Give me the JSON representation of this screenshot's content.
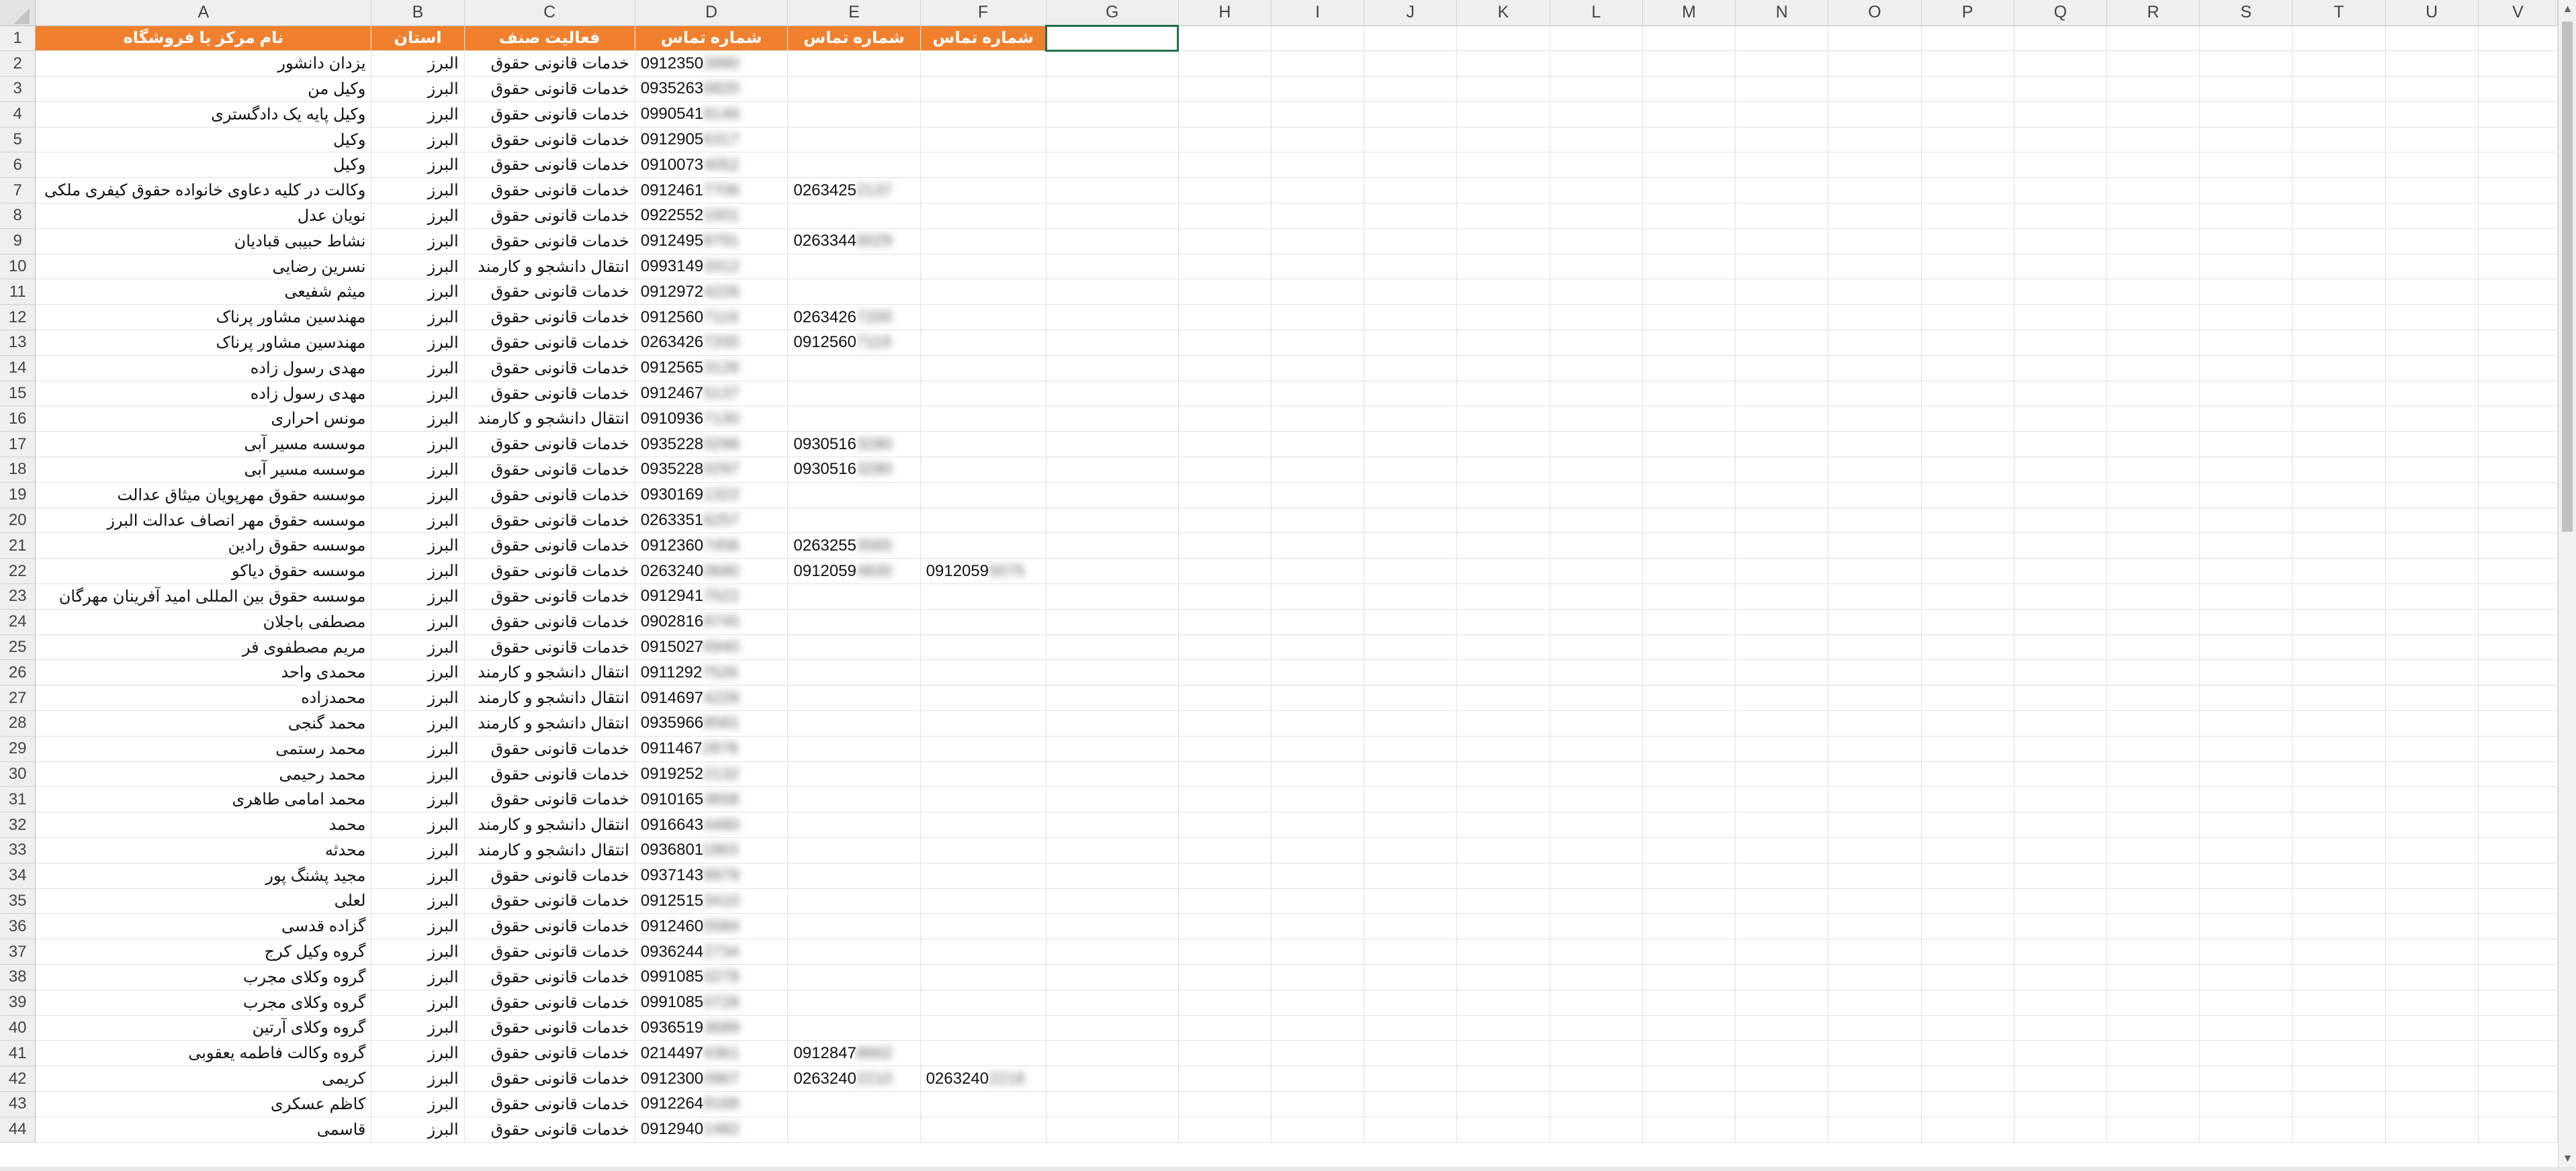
{
  "columns": [
    "A",
    "B",
    "C",
    "D",
    "E",
    "F",
    "G",
    "H",
    "I",
    "J",
    "K",
    "L",
    "M",
    "N",
    "O",
    "P",
    "Q",
    "R",
    "S",
    "T",
    "U",
    "V"
  ],
  "headers": {
    "a": "نام مرکز یا فروشگاه",
    "b": "استان",
    "c": "فعالیت صنف",
    "d": "شماره تماس",
    "e": "شماره تماس",
    "f": "شماره تماس"
  },
  "rows": [
    {
      "n": "2",
      "a": "یزدان دانشور",
      "b": "البرز",
      "c": "خدمات قانونی حقوق",
      "d1": "0912350",
      "d2": "3990",
      "e1": "",
      "e2": "",
      "f1": "",
      "f2": ""
    },
    {
      "n": "3",
      "a": "وکیل من",
      "b": "البرز",
      "c": "خدمات قانونی حقوق",
      "d1": "0935263",
      "d2": "6820",
      "e1": "",
      "e2": "",
      "f1": "",
      "f2": ""
    },
    {
      "n": "4",
      "a": "وکیل پایه یک دادگستری",
      "b": "البرز",
      "c": "خدمات قانونی حقوق",
      "d1": "0990541",
      "d2": "8146",
      "e1": "",
      "e2": "",
      "f1": "",
      "f2": ""
    },
    {
      "n": "5",
      "a": "وکیل",
      "b": "البرز",
      "c": "خدمات قانونی حقوق",
      "d1": "0912905",
      "d2": "6317",
      "e1": "",
      "e2": "",
      "f1": "",
      "f2": ""
    },
    {
      "n": "6",
      "a": "وکیل",
      "b": "البرز",
      "c": "خدمات قانونی حقوق",
      "d1": "0910073",
      "d2": "4052",
      "e1": "",
      "e2": "",
      "f1": "",
      "f2": ""
    },
    {
      "n": "7",
      "a": "وکالت در کلیه دعاوی خانواده حقوق کیفری ملکی",
      "b": "البرز",
      "c": "خدمات قانونی حقوق",
      "d1": "0912461",
      "d2": "7706",
      "e1": "0263425",
      "e2": "2137",
      "f1": "",
      "f2": ""
    },
    {
      "n": "8",
      "a": "نویان عدل",
      "b": "البرز",
      "c": "خدمات قانونی حقوق",
      "d1": "0922552",
      "d2": "1501",
      "e1": "",
      "e2": "",
      "f1": "",
      "f2": ""
    },
    {
      "n": "9",
      "a": "نشاط حبیبی قبادیان",
      "b": "البرز",
      "c": "خدمات قانونی حقوق",
      "d1": "0912495",
      "d2": "8791",
      "e1": "0263344",
      "e2": "0029",
      "f1": "",
      "f2": ""
    },
    {
      "n": "10",
      "a": "نسرین رضایی",
      "b": "البرز",
      "c": "انتقال دانشجو و کارمند",
      "d1": "0993149",
      "d2": "3312",
      "e1": "",
      "e2": "",
      "f1": "",
      "f2": ""
    },
    {
      "n": "11",
      "a": "میثم شفیعی",
      "b": "البرز",
      "c": "خدمات قانونی حقوق",
      "d1": "0912972",
      "d2": "4226",
      "e1": "",
      "e2": "",
      "f1": "",
      "f2": ""
    },
    {
      "n": "12",
      "a": "مهندسین مشاور پرناک",
      "b": "البرز",
      "c": "خدمات قانونی حقوق",
      "d1": "0912560",
      "d2": "7119",
      "e1": "0263426",
      "e2": "7200",
      "f1": "",
      "f2": ""
    },
    {
      "n": "13",
      "a": "مهندسین مشاور پرناک",
      "b": "البرز",
      "c": "خدمات قانونی حقوق",
      "d1": "0263426",
      "d2": "7200",
      "e1": "0912560",
      "e2": "7119",
      "f1": "",
      "f2": ""
    },
    {
      "n": "14",
      "a": "مهدی رسول زاده",
      "b": "البرز",
      "c": "خدمات قانونی حقوق",
      "d1": "0912565",
      "d2": "3126",
      "e1": "",
      "e2": "",
      "f1": "",
      "f2": ""
    },
    {
      "n": "15",
      "a": "مهدی رسول زاده",
      "b": "البرز",
      "c": "خدمات قانونی حقوق",
      "d1": "0912467",
      "d2": "5137",
      "e1": "",
      "e2": "",
      "f1": "",
      "f2": ""
    },
    {
      "n": "16",
      "a": "مونس احراری",
      "b": "البرز",
      "c": "انتقال دانشجو و کارمند",
      "d1": "0910936",
      "d2": "7130",
      "e1": "",
      "e2": "",
      "f1": "",
      "f2": ""
    },
    {
      "n": "17",
      "a": "موسسه مسیر آبی",
      "b": "البرز",
      "c": "خدمات قانونی حقوق",
      "d1": "0935228",
      "d2": "0298",
      "e1": "0930516",
      "e2": "3280",
      "f1": "",
      "f2": ""
    },
    {
      "n": "18",
      "a": "موسسه مسیر آبی",
      "b": "البرز",
      "c": "خدمات قانونی حقوق",
      "d1": "0935228",
      "d2": "0297",
      "e1": "0930516",
      "e2": "3280",
      "f1": "",
      "f2": ""
    },
    {
      "n": "19",
      "a": "موسسه حقوق مهرپویان میثاق عدالت",
      "b": "البرز",
      "c": "خدمات قانونی حقوق",
      "d1": "0930169",
      "d2": "1322",
      "e1": "",
      "e2": "",
      "f1": "",
      "f2": ""
    },
    {
      "n": "20",
      "a": "موسسه حقوق مهر انصاف عدالت البرز",
      "b": "البرز",
      "c": "خدمات قانونی حقوق",
      "d1": "0263351",
      "d2": "6257",
      "e1": "",
      "e2": "",
      "f1": "",
      "f2": ""
    },
    {
      "n": "21",
      "a": "موسسه حقوق رادین",
      "b": "البرز",
      "c": "خدمات قانونی حقوق",
      "d1": "0912360",
      "d2": "7456",
      "e1": "0263255",
      "e2": "3565",
      "f1": "",
      "f2": ""
    },
    {
      "n": "22",
      "a": "موسسه حقوق دیاکو",
      "b": "البرز",
      "c": "خدمات قانونی حقوق",
      "d1": "0263240",
      "d2": "0680",
      "e1": "0912059",
      "e2": "4830",
      "f1": "0912059",
      "f2": "5075"
    },
    {
      "n": "23",
      "a": "موسسه حقوق بین المللی امید آفرینان مهرگان",
      "b": "البرز",
      "c": "خدمات قانونی حقوق",
      "d1": "0912941",
      "d2": "7522",
      "e1": "",
      "e2": "",
      "f1": "",
      "f2": ""
    },
    {
      "n": "24",
      "a": "مصطفی باجلان",
      "b": "البرز",
      "c": "خدمات قانونی حقوق",
      "d1": "0902816",
      "d2": "9745",
      "e1": "",
      "e2": "",
      "f1": "",
      "f2": ""
    },
    {
      "n": "25",
      "a": "مریم مصطفوی فر",
      "b": "البرز",
      "c": "خدمات قانونی حقوق",
      "d1": "0915027",
      "d2": "6940",
      "e1": "",
      "e2": "",
      "f1": "",
      "f2": ""
    },
    {
      "n": "26",
      "a": "محمدی واحد",
      "b": "البرز",
      "c": "انتقال دانشجو و کارمند",
      "d1": "0911292",
      "d2": "7526",
      "e1": "",
      "e2": "",
      "f1": "",
      "f2": ""
    },
    {
      "n": "27",
      "a": "محمدزاده",
      "b": "البرز",
      "c": "انتقال دانشجو و کارمند",
      "d1": "0914697",
      "d2": "4228",
      "e1": "",
      "e2": "",
      "f1": "",
      "f2": ""
    },
    {
      "n": "28",
      "a": "محمد گنجی",
      "b": "البرز",
      "c": "انتقال دانشجو و کارمند",
      "d1": "0935966",
      "d2": "8581",
      "e1": "",
      "e2": "",
      "f1": "",
      "f2": ""
    },
    {
      "n": "29",
      "a": "محمد رستمی",
      "b": "البرز",
      "c": "خدمات قانونی حقوق",
      "d1": "0911467",
      "d2": "2878",
      "e1": "",
      "e2": "",
      "f1": "",
      "f2": ""
    },
    {
      "n": "30",
      "a": "محمد رحیمی",
      "b": "البرز",
      "c": "خدمات قانونی حقوق",
      "d1": "0919252",
      "d2": "2132",
      "e1": "",
      "e2": "",
      "f1": "",
      "f2": ""
    },
    {
      "n": "31",
      "a": "محمد امامی طاهری",
      "b": "البرز",
      "c": "خدمات قانونی حقوق",
      "d1": "0910165",
      "d2": "3658",
      "e1": "",
      "e2": "",
      "f1": "",
      "f2": ""
    },
    {
      "n": "32",
      "a": "محمد",
      "b": "البرز",
      "c": "انتقال دانشجو و کارمند",
      "d1": "0916643",
      "d2": "4480",
      "e1": "",
      "e2": "",
      "f1": "",
      "f2": ""
    },
    {
      "n": "33",
      "a": "محدثه",
      "b": "البرز",
      "c": "انتقال دانشجو و کارمند",
      "d1": "0936801",
      "d2": "1863",
      "e1": "",
      "e2": "",
      "f1": "",
      "f2": ""
    },
    {
      "n": "34",
      "a": "مجید پشنگ پور",
      "b": "البرز",
      "c": "خدمات قانونی حقوق",
      "d1": "0937143",
      "d2": "9979",
      "e1": "",
      "e2": "",
      "f1": "",
      "f2": ""
    },
    {
      "n": "35",
      "a": "لعلی",
      "b": "البرز",
      "c": "خدمات قانونی حقوق",
      "d1": "0912515",
      "d2": "3410",
      "e1": "",
      "e2": "",
      "f1": "",
      "f2": ""
    },
    {
      "n": "36",
      "a": "گزاده قدسی",
      "b": "البرز",
      "c": "خدمات قانونی حقوق",
      "d1": "0912460",
      "d2": "5584",
      "e1": "",
      "e2": "",
      "f1": "",
      "f2": ""
    },
    {
      "n": "37",
      "a": "گروه وکیل کرج",
      "b": "البرز",
      "c": "خدمات قانونی حقوق",
      "d1": "0936244",
      "d2": "2734",
      "e1": "",
      "e2": "",
      "f1": "",
      "f2": ""
    },
    {
      "n": "38",
      "a": "گروه وکلای مجرب",
      "b": "البرز",
      "c": "خدمات قانونی حقوق",
      "d1": "0991085",
      "d2": "0278",
      "e1": "",
      "e2": "",
      "f1": "",
      "f2": ""
    },
    {
      "n": "39",
      "a": "گروه وکلای مجرب",
      "b": "البرز",
      "c": "خدمات قانونی حقوق",
      "d1": "0991085",
      "d2": "0728",
      "e1": "",
      "e2": "",
      "f1": "",
      "f2": ""
    },
    {
      "n": "40",
      "a": "گروه وکلای آرتین",
      "b": "البرز",
      "c": "خدمات قانونی حقوق",
      "d1": "0936519",
      "d2": "3689",
      "e1": "",
      "e2": "",
      "f1": "",
      "f2": ""
    },
    {
      "n": "41",
      "a": "گروه وکالت فاطمه یعقوبی",
      "b": "البرز",
      "c": "خدمات قانونی حقوق",
      "d1": "0214497",
      "d2": "4361",
      "e1": "0912847",
      "e2": "8662",
      "f1": "",
      "f2": ""
    },
    {
      "n": "42",
      "a": "کریمی",
      "b": "البرز",
      "c": "خدمات قانونی حقوق",
      "d1": "0912300",
      "d2": "0967",
      "e1": "0263240",
      "e2": "2210",
      "f1": "0263240",
      "f2": "2218"
    },
    {
      "n": "43",
      "a": "کاظم عسکری",
      "b": "البرز",
      "c": "خدمات قانونی حقوق",
      "d1": "0912264",
      "d2": "9168",
      "e1": "",
      "e2": "",
      "f1": "",
      "f2": ""
    },
    {
      "n": "44",
      "a": "قاسمی",
      "b": "البرز",
      "c": "خدمات قانونی حقوق",
      "d1": "0912940",
      "d2": "1482",
      "e1": "",
      "e2": "",
      "f1": "",
      "f2": ""
    }
  ],
  "colors": {
    "header_fill": "#f0802e",
    "selection": "#1e7145",
    "gridline": "#e1e1e1"
  },
  "icons": {
    "scroll_up": "scroll-up-arrow-icon",
    "scroll_down": "scroll-down-arrow-icon",
    "select_all": "select-all-triangle-icon"
  }
}
